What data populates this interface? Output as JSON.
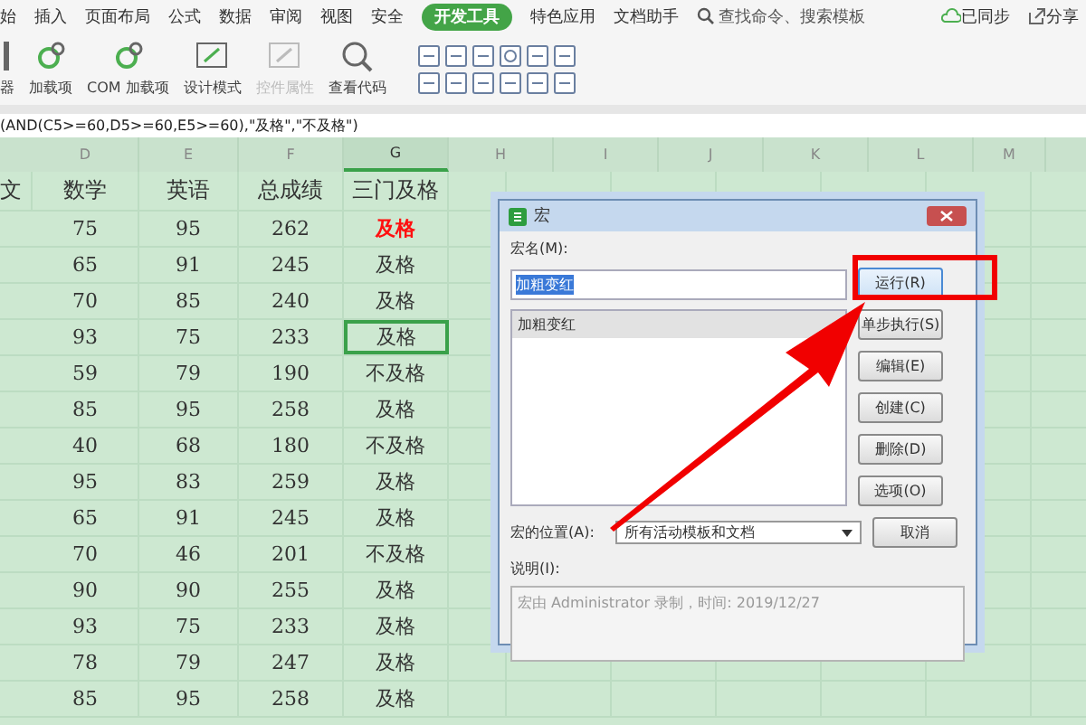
{
  "menu": {
    "tabs": [
      {
        "label": "始",
        "selected": false
      },
      {
        "label": "插入",
        "selected": false
      },
      {
        "label": "页面布局",
        "selected": false
      },
      {
        "label": "公式",
        "selected": false
      },
      {
        "label": "数据",
        "selected": false
      },
      {
        "label": "审阅",
        "selected": false
      },
      {
        "label": "视图",
        "selected": false
      },
      {
        "label": "安全",
        "selected": false
      },
      {
        "label": "开发工具",
        "selected": true
      },
      {
        "label": "特色应用",
        "selected": false
      },
      {
        "label": "文档助手",
        "selected": false
      }
    ],
    "search": {
      "placeholder": "查找命令、搜索模板"
    },
    "sync": "已同步",
    "share": "分享"
  },
  "ribbon": {
    "tools": [
      {
        "label": "器",
        "kind": "cut",
        "disabled": false
      },
      {
        "label": "加载项",
        "kind": "addin",
        "disabled": false
      },
      {
        "label": "COM 加载项",
        "kind": "com",
        "disabled": false
      },
      {
        "label": "设计模式",
        "kind": "design",
        "disabled": false
      },
      {
        "label": "控件属性",
        "kind": "props",
        "disabled": true
      },
      {
        "label": "查看代码",
        "kind": "code",
        "disabled": false
      }
    ]
  },
  "formula_bar": {
    "text": "(AND(C5>=60,D5>=60,E5>=60),\"及格\",\"不及格\")"
  },
  "sheet": {
    "columns": [
      {
        "label": "D",
        "selected": false
      },
      {
        "label": "E",
        "selected": false
      },
      {
        "label": "F",
        "selected": false
      },
      {
        "label": "G",
        "selected": true
      },
      {
        "label": "H",
        "selected": false
      },
      {
        "label": "I",
        "selected": false
      },
      {
        "label": "J",
        "selected": false
      },
      {
        "label": "K",
        "selected": false
      },
      {
        "label": "L",
        "selected": false
      },
      {
        "label": "M",
        "selected": false
      }
    ],
    "header": {
      "column_c": "文",
      "math": "数学",
      "english": "英语",
      "total": "总成绩",
      "result": "三门及格"
    },
    "rows": [
      {
        "math": "75",
        "english": "95",
        "total": "262",
        "result": "及格",
        "emphasis": true,
        "selected": false
      },
      {
        "math": "65",
        "english": "91",
        "total": "245",
        "result": "及格",
        "emphasis": false,
        "selected": false
      },
      {
        "math": "70",
        "english": "85",
        "total": "240",
        "result": "及格",
        "emphasis": false,
        "selected": false
      },
      {
        "math": "93",
        "english": "75",
        "total": "233",
        "result": "及格",
        "emphasis": false,
        "selected": true
      },
      {
        "math": "59",
        "english": "79",
        "total": "190",
        "result": "不及格",
        "emphasis": false,
        "selected": false
      },
      {
        "math": "85",
        "english": "95",
        "total": "258",
        "result": "及格",
        "emphasis": false,
        "selected": false
      },
      {
        "math": "40",
        "english": "68",
        "total": "180",
        "result": "不及格",
        "emphasis": false,
        "selected": false
      },
      {
        "math": "95",
        "english": "83",
        "total": "259",
        "result": "及格",
        "emphasis": false,
        "selected": false
      },
      {
        "math": "65",
        "english": "91",
        "total": "245",
        "result": "及格",
        "emphasis": false,
        "selected": false
      },
      {
        "math": "70",
        "english": "46",
        "total": "201",
        "result": "不及格",
        "emphasis": false,
        "selected": false
      },
      {
        "math": "90",
        "english": "90",
        "total": "255",
        "result": "及格",
        "emphasis": false,
        "selected": false
      },
      {
        "math": "93",
        "english": "75",
        "total": "233",
        "result": "及格",
        "emphasis": false,
        "selected": false
      },
      {
        "math": "78",
        "english": "79",
        "total": "247",
        "result": "及格",
        "emphasis": false,
        "selected": false
      },
      {
        "math": "85",
        "english": "95",
        "total": "258",
        "result": "及格",
        "emphasis": false,
        "selected": false
      }
    ]
  },
  "dialog": {
    "title": "宏",
    "name_label": "宏名(M):",
    "name_value": "加粗变红",
    "macros": [
      {
        "label": "加粗变红",
        "selected": true
      }
    ],
    "buttons": [
      {
        "label": "运行(R)",
        "highlighted": true
      },
      {
        "label": "单步执行(S)",
        "highlighted": false
      },
      {
        "label": "编辑(E)",
        "highlighted": false
      },
      {
        "label": "创建(C)",
        "highlighted": false
      },
      {
        "label": "删除(D)",
        "highlighted": false
      },
      {
        "label": "选项(O)",
        "highlighted": false
      }
    ],
    "location_label": "宏的位置(A):",
    "location_value": "所有活动模板和文档",
    "cancel": "取消",
    "description_label": "说明(I):",
    "description": "宏由 Administrator 录制，时间: 2019/12/27"
  }
}
